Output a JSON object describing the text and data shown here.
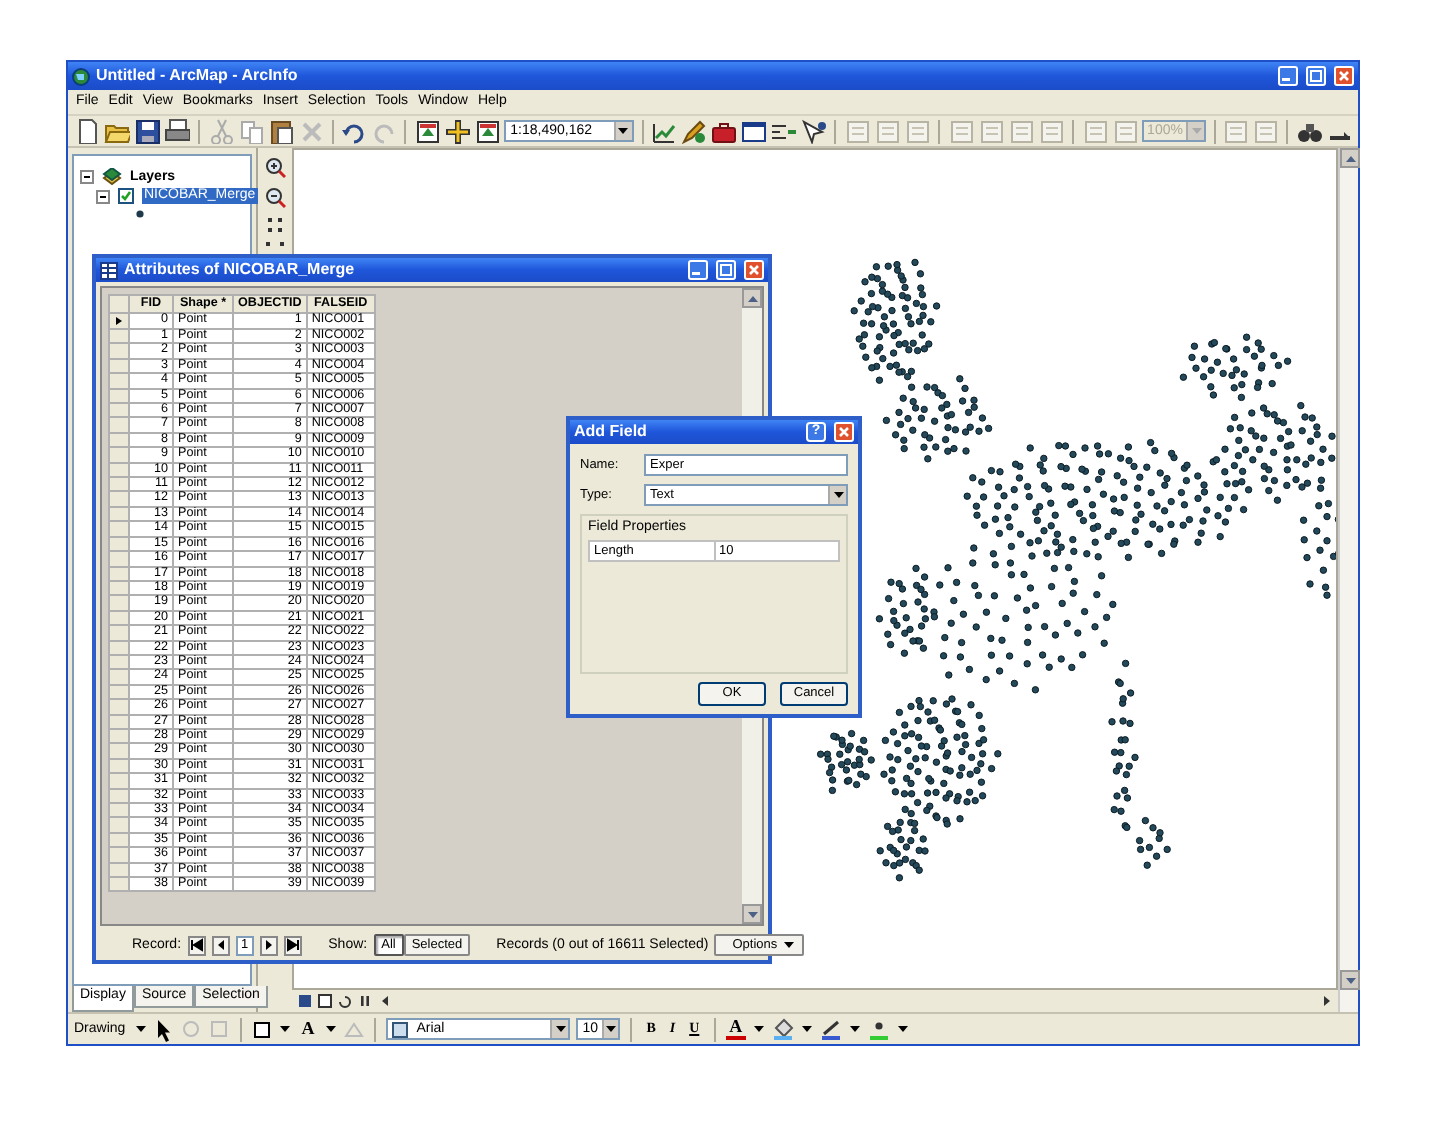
{
  "window": {
    "title": "Untitled - ArcMap - ArcInfo"
  },
  "menu": [
    "File",
    "Edit",
    "View",
    "Bookmarks",
    "Insert",
    "Selection",
    "Tools",
    "Window",
    "Help"
  ],
  "toolbar": {
    "scale": "1:18,490,162",
    "zoom": "100%"
  },
  "toc": {
    "root": {
      "label": "Layers",
      "expanded": true
    },
    "layers": [
      {
        "label": "NICOBAR_Merge",
        "checked": true,
        "selected": true,
        "expanded": true
      }
    ],
    "tabs": [
      {
        "label": "Display",
        "selected": true
      },
      {
        "label": "Source",
        "selected": false
      },
      {
        "label": "Selection",
        "selected": false
      }
    ]
  },
  "attributes": {
    "title": "Attributes of NICOBAR_Merge",
    "columns": [
      "FID",
      "Shape *",
      "OBJECTID",
      "FALSEID"
    ],
    "rows": [
      {
        "cells": [
          "0",
          "Point",
          "1",
          "NICO001"
        ],
        "current": true
      },
      {
        "cells": [
          "1",
          "Point",
          "2",
          "NICO002"
        ],
        "current": false
      },
      {
        "cells": [
          "2",
          "Point",
          "3",
          "NICO003"
        ],
        "current": false
      },
      {
        "cells": [
          "3",
          "Point",
          "4",
          "NICO004"
        ],
        "current": false
      },
      {
        "cells": [
          "4",
          "Point",
          "5",
          "NICO005"
        ],
        "current": false
      },
      {
        "cells": [
          "5",
          "Point",
          "6",
          "NICO006"
        ],
        "current": false
      },
      {
        "cells": [
          "6",
          "Point",
          "7",
          "NICO007"
        ],
        "current": false
      },
      {
        "cells": [
          "7",
          "Point",
          "8",
          "NICO008"
        ],
        "current": false
      },
      {
        "cells": [
          "8",
          "Point",
          "9",
          "NICO009"
        ],
        "current": false
      },
      {
        "cells": [
          "9",
          "Point",
          "10",
          "NICO010"
        ],
        "current": false
      },
      {
        "cells": [
          "10",
          "Point",
          "11",
          "NICO011"
        ],
        "current": false
      },
      {
        "cells": [
          "11",
          "Point",
          "12",
          "NICO012"
        ],
        "current": false
      },
      {
        "cells": [
          "12",
          "Point",
          "13",
          "NICO013"
        ],
        "current": false
      },
      {
        "cells": [
          "13",
          "Point",
          "14",
          "NICO014"
        ],
        "current": false
      },
      {
        "cells": [
          "14",
          "Point",
          "15",
          "NICO015"
        ],
        "current": false
      },
      {
        "cells": [
          "15",
          "Point",
          "16",
          "NICO016"
        ],
        "current": false
      },
      {
        "cells": [
          "16",
          "Point",
          "17",
          "NICO017"
        ],
        "current": false
      },
      {
        "cells": [
          "17",
          "Point",
          "18",
          "NICO018"
        ],
        "current": false
      },
      {
        "cells": [
          "18",
          "Point",
          "19",
          "NICO019"
        ],
        "current": false
      },
      {
        "cells": [
          "19",
          "Point",
          "20",
          "NICO020"
        ],
        "current": false
      },
      {
        "cells": [
          "20",
          "Point",
          "21",
          "NICO021"
        ],
        "current": false
      },
      {
        "cells": [
          "21",
          "Point",
          "22",
          "NICO022"
        ],
        "current": false
      },
      {
        "cells": [
          "22",
          "Point",
          "23",
          "NICO023"
        ],
        "current": false
      },
      {
        "cells": [
          "23",
          "Point",
          "24",
          "NICO024"
        ],
        "current": false
      },
      {
        "cells": [
          "24",
          "Point",
          "25",
          "NICO025"
        ],
        "current": false
      },
      {
        "cells": [
          "25",
          "Point",
          "26",
          "NICO026"
        ],
        "current": false
      },
      {
        "cells": [
          "26",
          "Point",
          "27",
          "NICO027"
        ],
        "current": false
      },
      {
        "cells": [
          "27",
          "Point",
          "28",
          "NICO028"
        ],
        "current": false
      },
      {
        "cells": [
          "28",
          "Point",
          "29",
          "NICO029"
        ],
        "current": false
      },
      {
        "cells": [
          "29",
          "Point",
          "30",
          "NICO030"
        ],
        "current": false
      },
      {
        "cells": [
          "30",
          "Point",
          "31",
          "NICO031"
        ],
        "current": false
      },
      {
        "cells": [
          "31",
          "Point",
          "32",
          "NICO032"
        ],
        "current": false
      },
      {
        "cells": [
          "32",
          "Point",
          "33",
          "NICO033"
        ],
        "current": false
      },
      {
        "cells": [
          "33",
          "Point",
          "34",
          "NICO034"
        ],
        "current": false
      },
      {
        "cells": [
          "34",
          "Point",
          "35",
          "NICO035"
        ],
        "current": false
      },
      {
        "cells": [
          "35",
          "Point",
          "36",
          "NICO036"
        ],
        "current": false
      },
      {
        "cells": [
          "36",
          "Point",
          "37",
          "NICO037"
        ],
        "current": false
      },
      {
        "cells": [
          "37",
          "Point",
          "38",
          "NICO038"
        ],
        "current": false
      },
      {
        "cells": [
          "38",
          "Point",
          "39",
          "NICO039"
        ],
        "current": false
      }
    ],
    "record_label": "Record:",
    "record_value": "1",
    "show_label": "Show:",
    "show_buttons": [
      {
        "label": "All",
        "selected": true
      },
      {
        "label": "Selected",
        "selected": false
      }
    ],
    "status": "Records (0 out of 16611 Selected)",
    "options": "Options"
  },
  "add_field": {
    "title": "Add Field",
    "help": "?",
    "name_label": "Name:",
    "name_value": "Exper",
    "type_label": "Type:",
    "type_value": "Text",
    "group": "Field Properties",
    "properties": [
      {
        "name": "Length",
        "value": "10"
      }
    ],
    "buttons": [
      "OK",
      "Cancel"
    ]
  },
  "drawing_toolbar": {
    "menu": "Drawing",
    "text_tool": "A",
    "font": "Arial",
    "size": "10",
    "styles": [
      "B",
      "I",
      "U"
    ],
    "font_color": "A"
  }
}
